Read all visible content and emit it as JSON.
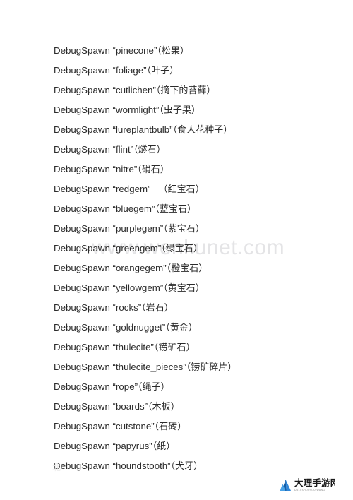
{
  "page": {
    "background_color": "#ffffff",
    "text_color": "#2b2b2b",
    "rule_color": "#b9b9b9",
    "corner_mark": "北"
  },
  "watermark": {
    "text": "www.wenkunet.com",
    "color": "#e4e4e6"
  },
  "command_list": {
    "prefix": "DebugSpawn",
    "items": [
      {
        "command": "DebugSpawn",
        "id": "“pinecone”",
        "gloss": "（松果）",
        "spacer": ""
      },
      {
        "command": "DebugSpawn",
        "id": "“foliage”",
        "gloss": "（叶子）",
        "spacer": ""
      },
      {
        "command": "DebugSpawn",
        "id": "“cutlichen”",
        "gloss": "（摘下的苔藓）",
        "spacer": ""
      },
      {
        "command": "DebugSpawn",
        "id": "“wormlight”",
        "gloss": "（虫子果）",
        "spacer": ""
      },
      {
        "command": "DebugSpawn",
        "id": "“lureplantbulb”",
        "gloss": "（食人花种子）",
        "spacer": ""
      },
      {
        "command": "DebugSpawn",
        "id": "“flint”",
        "gloss": "（燧石）",
        "spacer": ""
      },
      {
        "command": "DebugSpawn",
        "id": "“nitre”",
        "gloss": "（硝石）",
        "spacer": ""
      },
      {
        "command": "DebugSpawn",
        "id": "“redgem”",
        "gloss": "（红宝石）",
        "spacer": "   "
      },
      {
        "command": "DebugSpawn",
        "id": "“bluegem”",
        "gloss": "（蓝宝石）",
        "spacer": ""
      },
      {
        "command": "DebugSpawn",
        "id": "“purplegem”",
        "gloss": "（紫宝石）",
        "spacer": ""
      },
      {
        "command": "DebugSpawn",
        "id": "“greengem”",
        "gloss": "（绿宝石）",
        "spacer": ""
      },
      {
        "command": "DebugSpawn",
        "id": "“orangegem”",
        "gloss": "（橙宝石）",
        "spacer": ""
      },
      {
        "command": "DebugSpawn",
        "id": "“yellowgem”",
        "gloss": "（黄宝石）",
        "spacer": ""
      },
      {
        "command": "DebugSpawn",
        "id": "“rocks”",
        "gloss": "（岩石）",
        "spacer": ""
      },
      {
        "command": "DebugSpawn",
        "id": "“goldnugget”",
        "gloss": "（黄金）",
        "spacer": ""
      },
      {
        "command": "DebugSpawn",
        "id": "“thulecite”",
        "gloss": "（铹矿石）",
        "spacer": ""
      },
      {
        "command": "DebugSpawn",
        "id": "“thulecite_pieces”",
        "gloss": "（铹矿碎片）",
        "spacer": ""
      },
      {
        "command": "DebugSpawn",
        "id": "“rope”",
        "gloss": "（绳子）",
        "spacer": ""
      },
      {
        "command": "DebugSpawn",
        "id": "“boards”",
        "gloss": "（木板）",
        "spacer": ""
      },
      {
        "command": "DebugSpawn",
        "id": "“cutstone”",
        "gloss": "（石砖）",
        "spacer": ""
      },
      {
        "command": "DebugSpawn",
        "id": "“papyrus”",
        "gloss": "（纸）",
        "spacer": ""
      },
      {
        "command": "DebugSpawn",
        "id": "“houndstooth”",
        "gloss": "（犬牙）",
        "spacer": ""
      }
    ]
  },
  "site_badge": {
    "title": "大理手游网",
    "subtitle": "DALI SHOUYOU WANG",
    "logo_color": "#1a6fc4",
    "logo_color_dark": "#0e4f96"
  }
}
